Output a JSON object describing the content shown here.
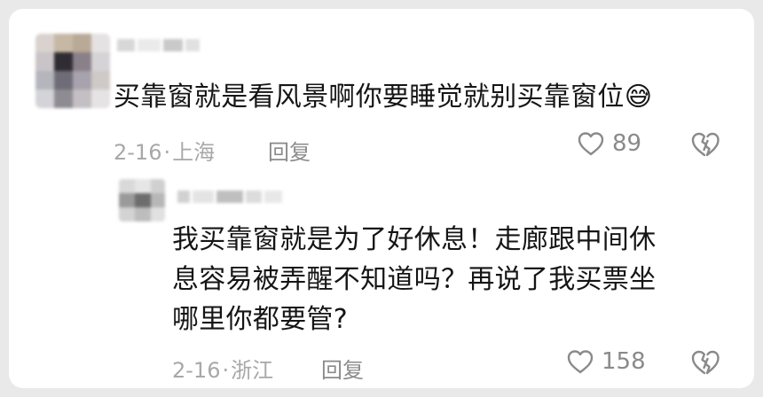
{
  "comments": [
    {
      "text": "买靠窗就是看风景啊你要睡觉就别买靠窗位",
      "emoji": "😅",
      "date": "2-16",
      "location": "上海",
      "reply_label": "回复",
      "likes": "89"
    }
  ],
  "replies": [
    {
      "text_lines": [
        "我买靠窗就是为了好休息！走廊跟中间休",
        "息容易被弄醒不知道吗？再说了我买票坐",
        "哪里你都要管?"
      ],
      "date": "2-16",
      "location": "浙江",
      "reply_label": "回复",
      "likes": "158"
    }
  ],
  "meta_separator": "·",
  "icons": {
    "like": "heart-outline-icon",
    "dislike": "broken-heart-icon"
  }
}
